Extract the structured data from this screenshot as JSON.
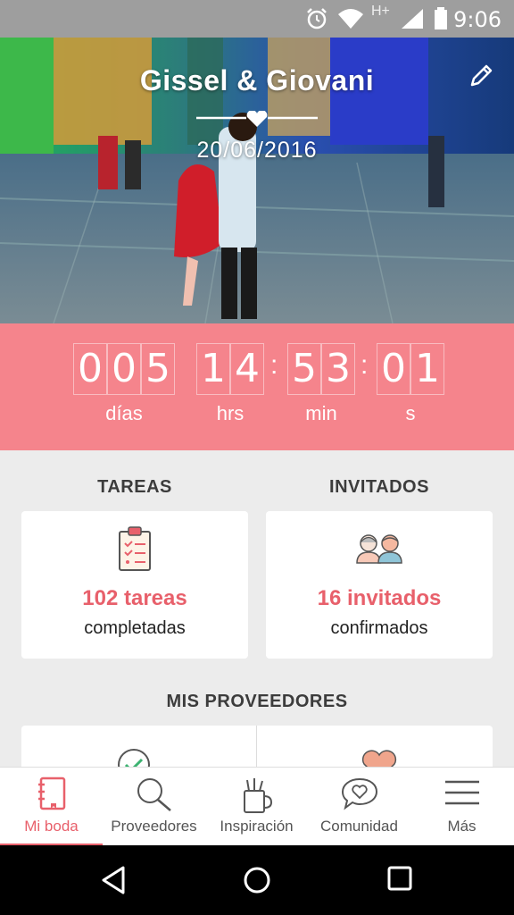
{
  "status_bar": {
    "time": "9:06",
    "network": "H+"
  },
  "hero": {
    "couple_names": "Gissel & Giovani",
    "wedding_date": "20/06/2016"
  },
  "countdown": {
    "days": [
      "0",
      "0",
      "5"
    ],
    "hours": [
      "1",
      "4"
    ],
    "minutes": [
      "5",
      "3"
    ],
    "seconds": [
      "0",
      "1"
    ],
    "labels": {
      "days": "días",
      "hours": "hrs",
      "minutes": "min",
      "seconds": "s"
    }
  },
  "tasks": {
    "title": "TAREAS",
    "count": "102 tareas",
    "status": "completadas"
  },
  "guests": {
    "title": "INVITADOS",
    "count": "16 invitados",
    "status": "confirmados"
  },
  "providers": {
    "title": "MIS PROVEEDORES"
  },
  "bottom_nav": [
    {
      "label": "Mi boda",
      "icon": "notebook-icon",
      "active": true
    },
    {
      "label": "Proveedores",
      "icon": "search-icon",
      "active": false
    },
    {
      "label": "Inspiración",
      "icon": "inspiration-icon",
      "active": false
    },
    {
      "label": "Comunidad",
      "icon": "chat-heart-icon",
      "active": false
    },
    {
      "label": "Más",
      "icon": "menu-icon",
      "active": false
    }
  ],
  "colors": {
    "accent": "#e8606b",
    "countdown_bg": "#f5848c",
    "status_bar": "#9e9e9e"
  }
}
